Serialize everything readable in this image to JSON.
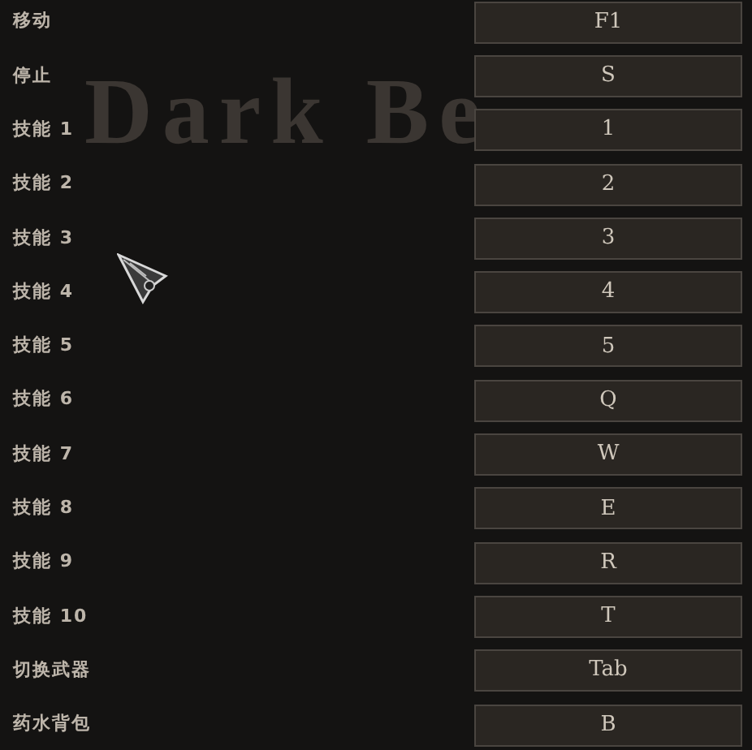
{
  "background_title": "Dark Be",
  "bindings": [
    {
      "action": "移动",
      "key": "F1"
    },
    {
      "action": "停止",
      "key": "S"
    },
    {
      "action": "技能 1",
      "key": "1"
    },
    {
      "action": "技能 2",
      "key": "2"
    },
    {
      "action": "技能 3",
      "key": "3"
    },
    {
      "action": "技能 4",
      "key": "4"
    },
    {
      "action": "技能 5",
      "key": "5"
    },
    {
      "action": "技能 6",
      "key": "Q"
    },
    {
      "action": "技能 7",
      "key": "W"
    },
    {
      "action": "技能 8",
      "key": "E"
    },
    {
      "action": "技能 9",
      "key": "R"
    },
    {
      "action": "技能 10",
      "key": "T"
    },
    {
      "action": "切换武器",
      "key": "Tab"
    },
    {
      "action": "药水背包",
      "key": "B"
    }
  ]
}
